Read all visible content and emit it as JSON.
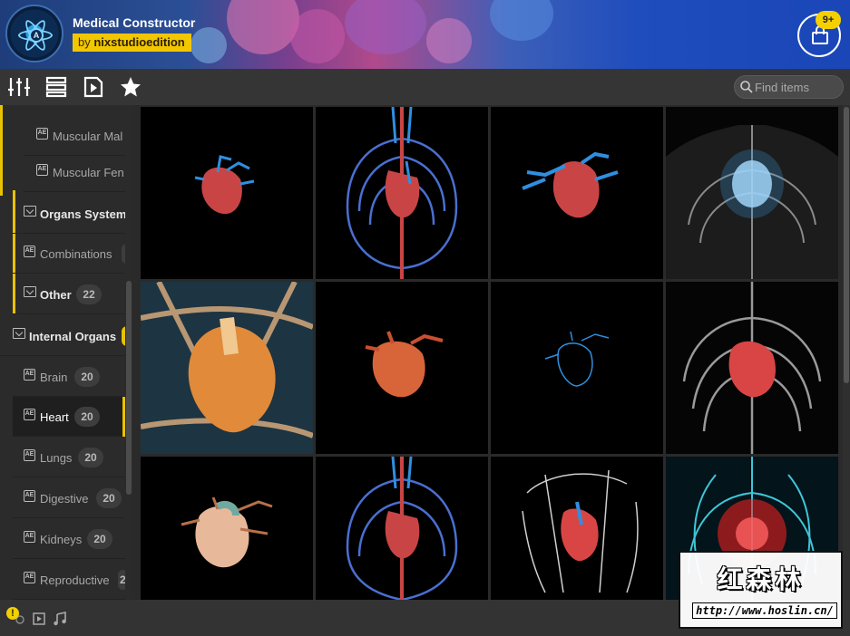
{
  "header": {
    "app_title": "Medical Constructor",
    "by_label": "by",
    "author": "nixstudioedition",
    "cart_badge": "9+"
  },
  "logo": {
    "letter": "A"
  },
  "toolbar": {
    "icons": [
      "sliders-icon",
      "list-icon",
      "play-file-icon",
      "star-icon"
    ],
    "search_placeholder": "Find items"
  },
  "sidebar": {
    "items": [
      {
        "label": "Muscular Mal",
        "type": "preset",
        "count": ""
      },
      {
        "label": "Muscular Fen",
        "type": "preset",
        "count": ""
      },
      {
        "label": "Organs System",
        "type": "category",
        "count": ""
      },
      {
        "label": "Combinations",
        "type": "preset",
        "count": ""
      },
      {
        "label": "Other",
        "type": "category",
        "count": "22"
      },
      {
        "label": "Internal Organs",
        "type": "category",
        "count": ""
      },
      {
        "label": "Brain",
        "type": "preset",
        "count": "20"
      },
      {
        "label": "Heart",
        "type": "preset",
        "count": "20",
        "selected": true
      },
      {
        "label": "Lungs",
        "type": "preset",
        "count": "20"
      },
      {
        "label": "Digestive",
        "type": "preset",
        "count": "20"
      },
      {
        "label": "Kidneys",
        "type": "preset",
        "count": "20"
      },
      {
        "label": "Reproductive",
        "type": "preset",
        "count": "2"
      }
    ]
  },
  "bottombar": {
    "warning": "!",
    "icons": [
      "preview-icon",
      "music-icon"
    ]
  },
  "watermark": {
    "chinese": "红森林",
    "url": "http://www.hoslin.cn/"
  },
  "colors": {
    "accent": "#e8c200",
    "artery": "#d44",
    "vein": "#2f8fe0"
  }
}
